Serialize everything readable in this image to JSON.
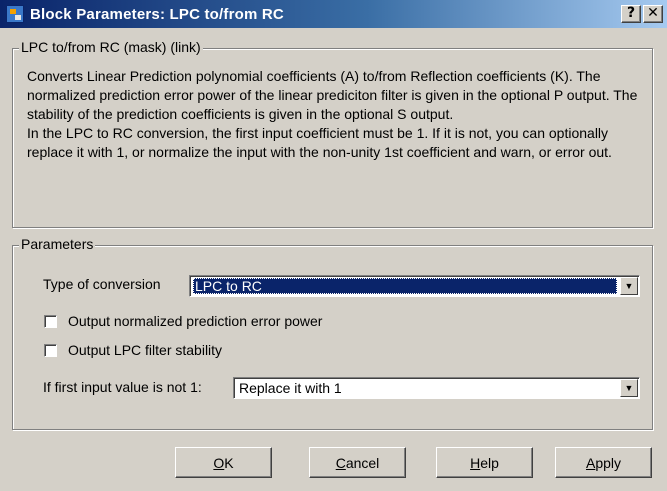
{
  "window": {
    "title": "Block Parameters: LPC to/from RC",
    "help_glyph": "?",
    "close_glyph": "✕"
  },
  "description_group": {
    "legend": "LPC to/from RC (mask) (link)",
    "paragraph1": "Converts Linear Prediction polynomial coefficients (A) to/from Reflection coefficients (K). The normalized prediction error power of the linear prediciton filter is given in the optional P output. The stability of the prediction coefficients is given in the optional S output.",
    "paragraph2": "In the LPC to RC conversion, the first input coefficient must be 1. If it is not, you can optionally replace it with 1, or normalize the input with the non-unity 1st coefficient and warn, or error out."
  },
  "parameters_group": {
    "legend": "Parameters",
    "conversion_label": "Type of conversion",
    "conversion_value": "LPC to RC",
    "checkbox1_label": "Output normalized prediction error power",
    "checkbox1_checked": false,
    "checkbox2_label": "Output LPC filter stability",
    "checkbox2_checked": false,
    "first_input_label": "If first input value is not 1:",
    "first_input_value": "Replace it with 1"
  },
  "buttons": {
    "ok": {
      "mnemonic": "O",
      "rest": "K"
    },
    "cancel": {
      "mnemonic": "C",
      "rest": "ancel"
    },
    "help": {
      "mnemonic": "H",
      "rest": "elp"
    },
    "apply": {
      "mnemonic": "A",
      "rest": "pply"
    }
  },
  "colors": {
    "face": "#d4d0c8",
    "title_start": "#0a246a",
    "title_end": "#a6caf0",
    "selection": "#0a246a"
  },
  "icons": {
    "app": "simulink-block-icon",
    "dropdown": "chevron-down-icon"
  }
}
